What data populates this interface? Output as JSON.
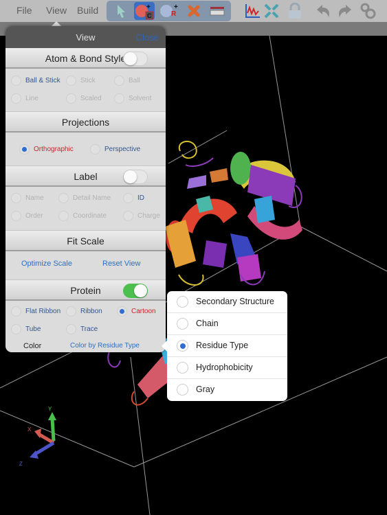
{
  "menubar": {
    "items": [
      "File",
      "View",
      "Build"
    ],
    "tools": [
      {
        "icon": "select-arrow-icon",
        "active": false
      },
      {
        "icon": "add-carbon-atom-icon",
        "active": true,
        "badge": "C"
      },
      {
        "icon": "add-r-group-icon",
        "active": false,
        "badge": "R"
      },
      {
        "icon": "delete-x-icon",
        "active": false
      },
      {
        "icon": "ruler-icon",
        "active": false
      }
    ],
    "right_tools": [
      "graph-icon",
      "fit-screen-icon",
      "lock-icon",
      "undo-icon",
      "redo-icon",
      "settings-gears-icon"
    ]
  },
  "view_panel": {
    "title": "View",
    "close_label": "Close",
    "atom_bond": {
      "title": "Atom & Bond Style",
      "enabled": false,
      "options": [
        {
          "label": "Ball & Stick",
          "selected": false,
          "style": "blue"
        },
        {
          "label": "Stick",
          "selected": false,
          "style": "dim"
        },
        {
          "label": "Ball",
          "selected": false,
          "style": "dim"
        },
        {
          "label": "Line",
          "selected": false,
          "style": "dim"
        },
        {
          "label": "Scaled",
          "selected": false,
          "style": "dim"
        },
        {
          "label": "Solvent",
          "selected": false,
          "style": "dim"
        }
      ]
    },
    "projections": {
      "title": "Projections",
      "options": [
        {
          "label": "Orthographic",
          "selected": true
        },
        {
          "label": "Perspective",
          "selected": false
        }
      ]
    },
    "label": {
      "title": "Label",
      "enabled": false,
      "options": [
        {
          "label": "Name",
          "selected": false,
          "style": "dim"
        },
        {
          "label": "Detail Name",
          "selected": false,
          "style": "dim"
        },
        {
          "label": "ID",
          "selected": false,
          "style": "blue"
        },
        {
          "label": "Order",
          "selected": false,
          "style": "dim"
        },
        {
          "label": "Coordinate",
          "selected": false,
          "style": "dim"
        },
        {
          "label": "Charge",
          "selected": false,
          "style": "dim"
        }
      ]
    },
    "fit_scale": {
      "title": "Fit Scale",
      "optimize_label": "Optimize Scale",
      "reset_label": "Reset View"
    },
    "protein": {
      "title": "Protein",
      "enabled": true,
      "options": [
        {
          "label": "Flat Ribbon",
          "selected": false
        },
        {
          "label": "Ribbon",
          "selected": false
        },
        {
          "label": "Cartoon",
          "selected": true
        },
        {
          "label": "Tube",
          "selected": false
        },
        {
          "label": "Trace",
          "selected": false
        }
      ],
      "color_label": "Color",
      "color_value": "Color by Residue Type"
    }
  },
  "color_popover": {
    "options": [
      {
        "label": "Secondary Structure",
        "selected": false
      },
      {
        "label": "Chain",
        "selected": false
      },
      {
        "label": "Residue Type",
        "selected": true
      },
      {
        "label": "Hydrophobicity",
        "selected": false
      },
      {
        "label": "Gray",
        "selected": false
      }
    ]
  },
  "axes": {
    "x": "X",
    "y": "Y",
    "z": "Z"
  },
  "colors": {
    "accent_blue": "#2f6dd0",
    "selected_red": "#c7262d",
    "toggle_on": "#4cbf4f",
    "toolbar_group": "#8396ac"
  }
}
